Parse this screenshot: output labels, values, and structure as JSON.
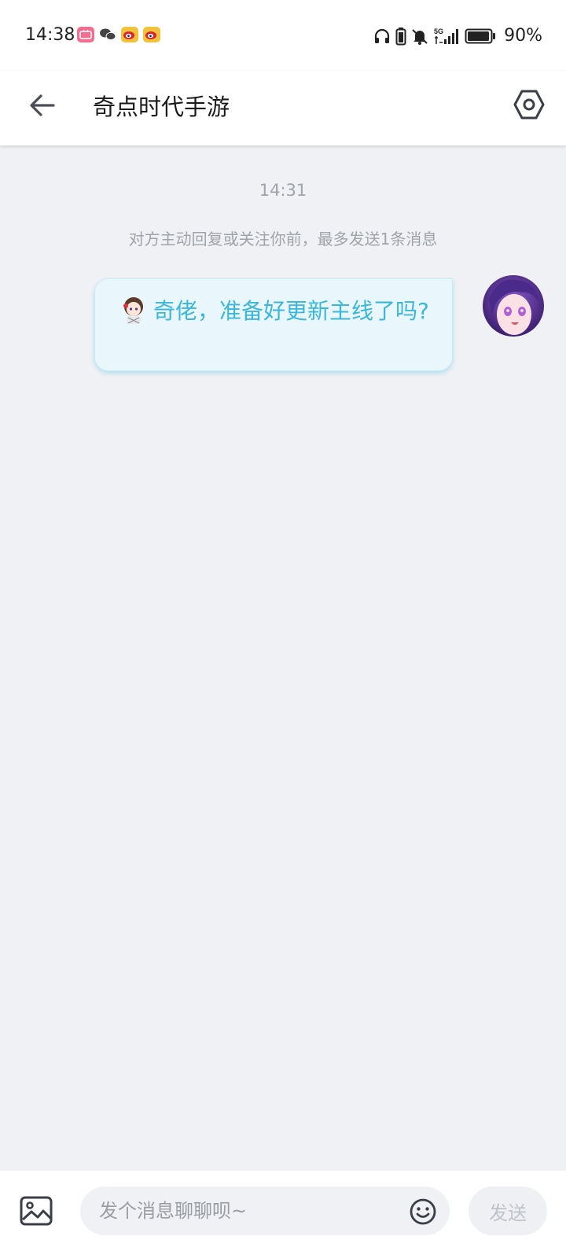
{
  "status_bar": {
    "time": "14:38",
    "battery_percent": "90%",
    "notification_icons": [
      "bilibili-icon",
      "wechat-icon",
      "weibo-icon",
      "weibo-icon"
    ],
    "system_icons": [
      "headphones-icon",
      "battery-saver-icon",
      "mute-icon",
      "signal-5g-icon",
      "battery-icon"
    ]
  },
  "app_bar": {
    "title": "奇点时代手游"
  },
  "chat": {
    "timestamp": "14:31",
    "notice": "对方主动回复或关注你前，最多发送1条消息",
    "messages": [
      {
        "sender": "self",
        "text": "奇佬，准备好更新主线了吗?"
      }
    ]
  },
  "composer": {
    "placeholder": "发个消息聊聊呗~",
    "send_label": "发送"
  },
  "colors": {
    "accent": "#3bb6dd",
    "bubble_bg": "#e9f7fd",
    "page_bg": "#f0f1f4"
  }
}
